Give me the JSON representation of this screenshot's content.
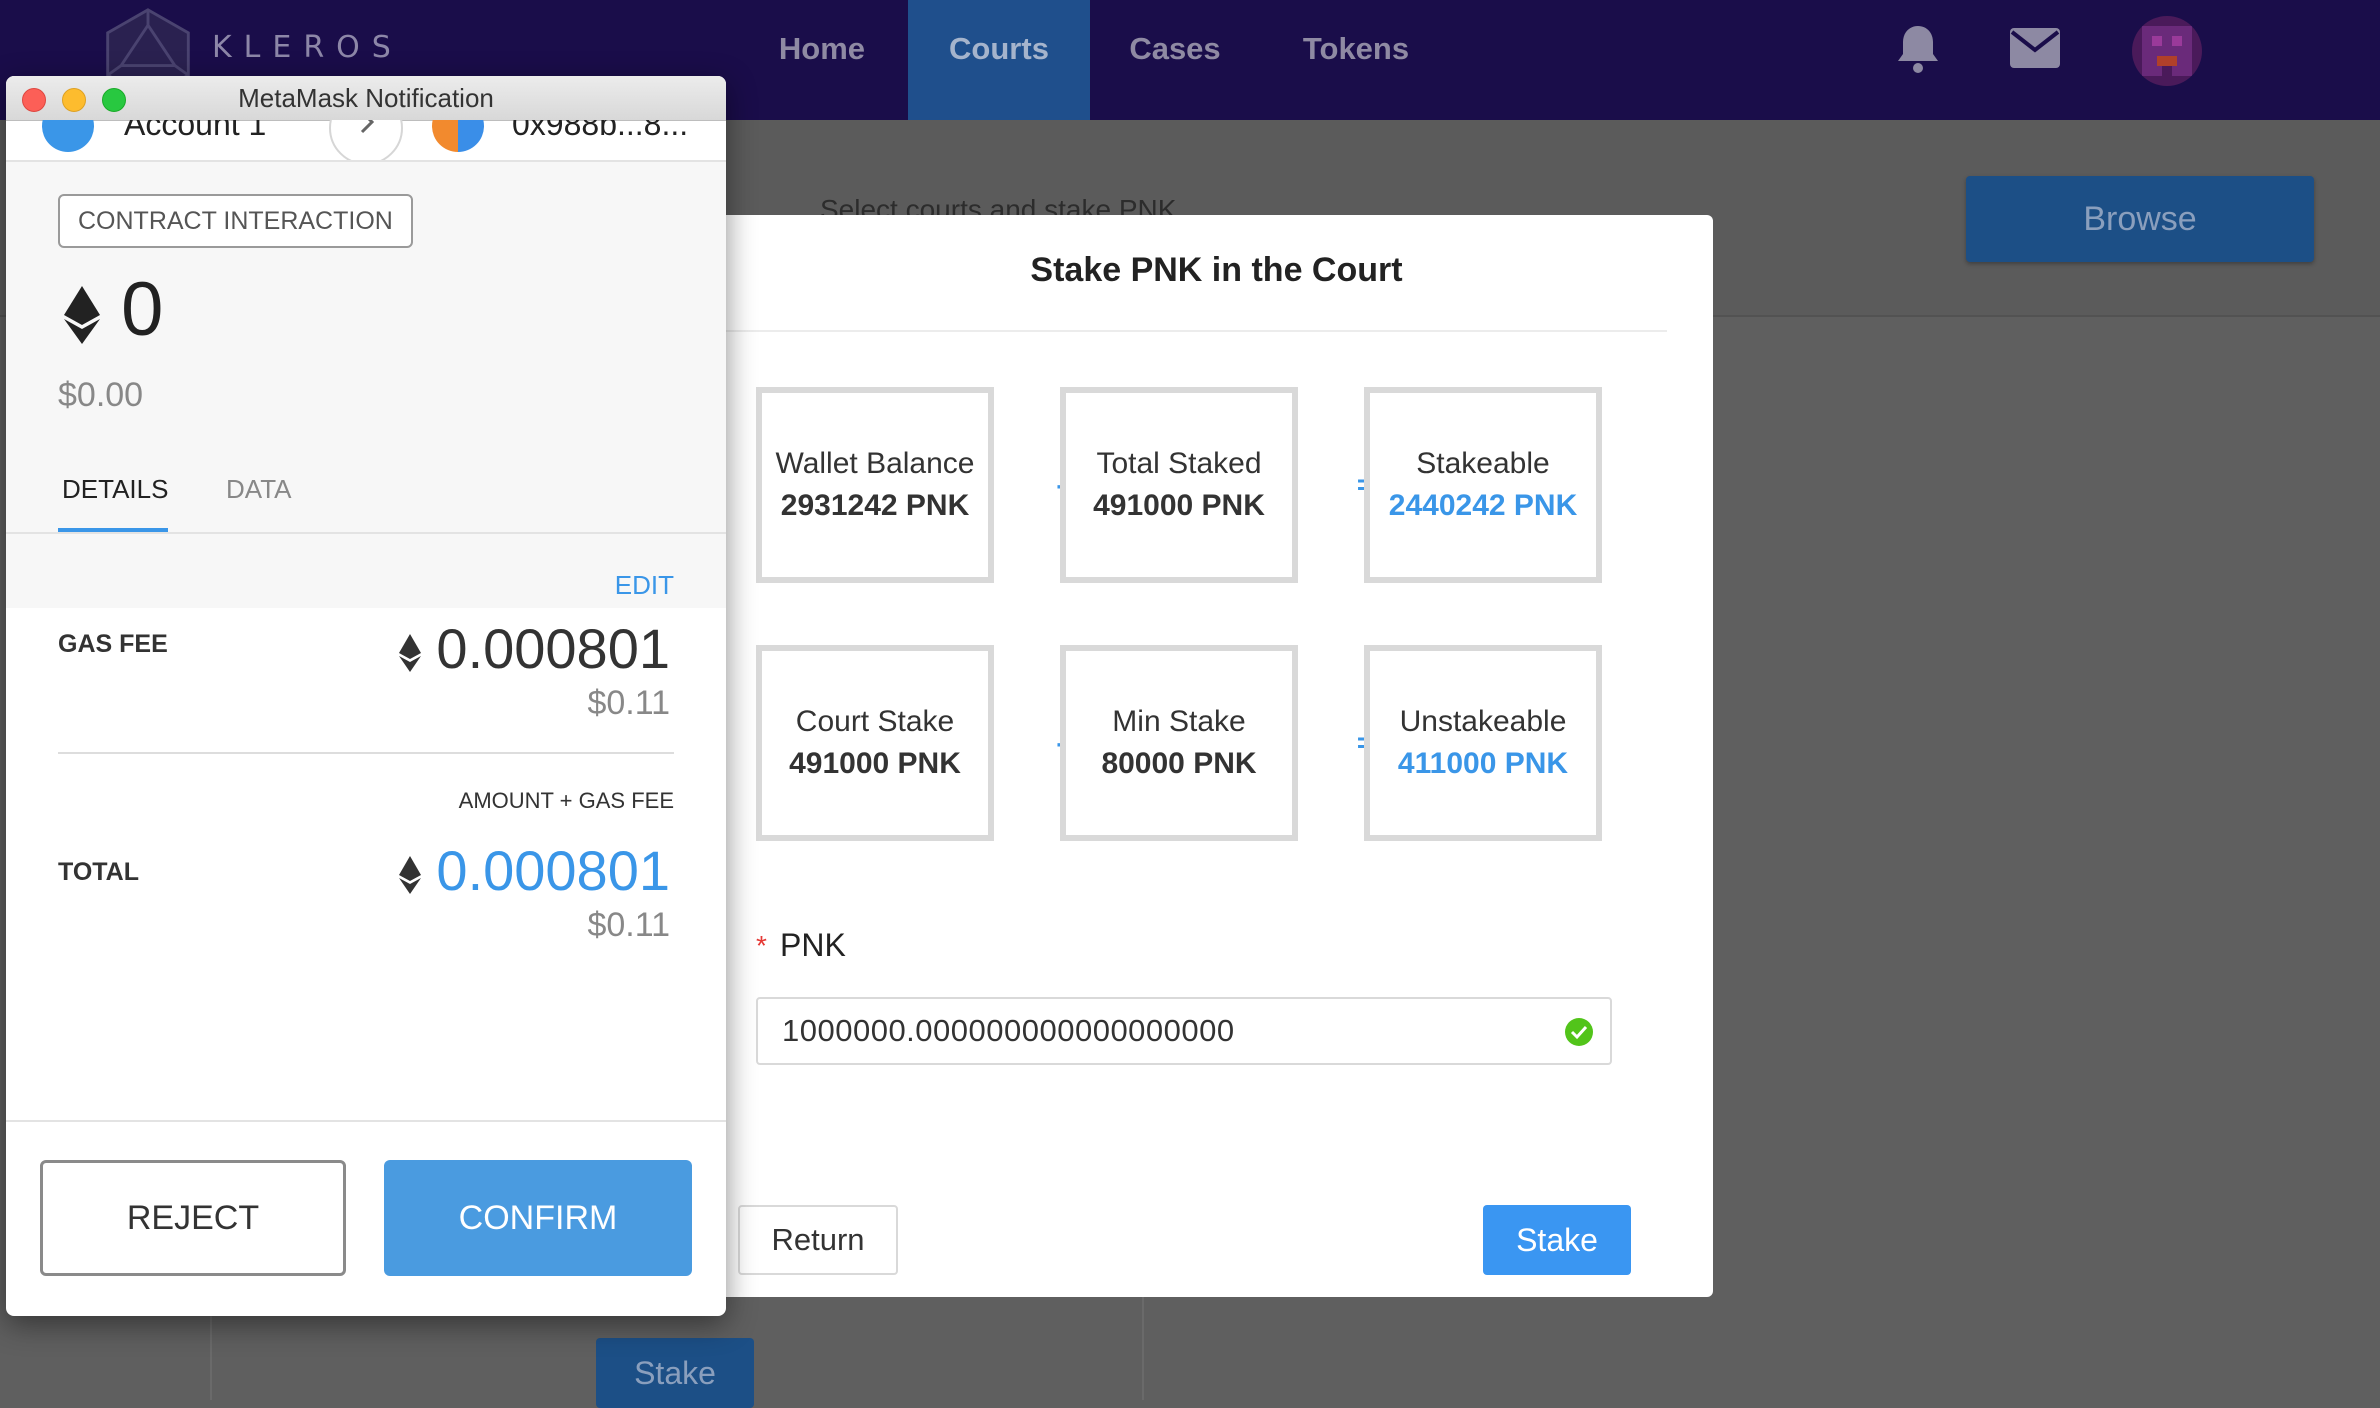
{
  "app": {
    "logo_text": "KLEROS",
    "nav": [
      {
        "label": "Home"
      },
      {
        "label": "Courts"
      },
      {
        "label": "Cases"
      },
      {
        "label": "Tokens"
      }
    ],
    "active_nav": "Courts",
    "page_subtitle": "Select courts and stake PNK",
    "browse_label": "Browse",
    "bg_stake_label": "Stake"
  },
  "modal": {
    "title": "Stake PNK in the Court",
    "row1": [
      {
        "label": "Wallet Balance",
        "value": "2931242 PNK"
      },
      {
        "label": "Total Staked",
        "value": "491000 PNK"
      },
      {
        "label": "Stakeable",
        "value": "2440242 PNK"
      }
    ],
    "row2": [
      {
        "label": "Court Stake",
        "value": "491000 PNK"
      },
      {
        "label": "Min Stake",
        "value": "80000 PNK"
      },
      {
        "label": "Unstakeable",
        "value": "411000 PNK"
      }
    ],
    "minus": "-",
    "equals": "=",
    "required_mark": "*",
    "input_label": "PNK",
    "input_value": "1000000.000000000000000000",
    "return_label": "Return",
    "stake_label": "Stake",
    "accent_color": "#3a96e8"
  },
  "metamask": {
    "window_title": "MetaMask Notification",
    "from_account": "Account 1",
    "to_account": "0x988b...8...",
    "tag": "CONTRACT INTERACTION",
    "eth_amount": "0",
    "usd_amount": "$0.00",
    "tabs": [
      "DETAILS",
      "DATA"
    ],
    "edit_label": "EDIT",
    "gas_fee_label": "GAS FEE",
    "gas_fee_value": "0.000801",
    "gas_fee_usd": "$0.11",
    "amount_gas_label": "AMOUNT + GAS FEE",
    "total_label": "TOTAL",
    "total_value": "0.000801",
    "total_usd": "$0.11",
    "reject_label": "REJECT",
    "confirm_label": "CONFIRM"
  }
}
